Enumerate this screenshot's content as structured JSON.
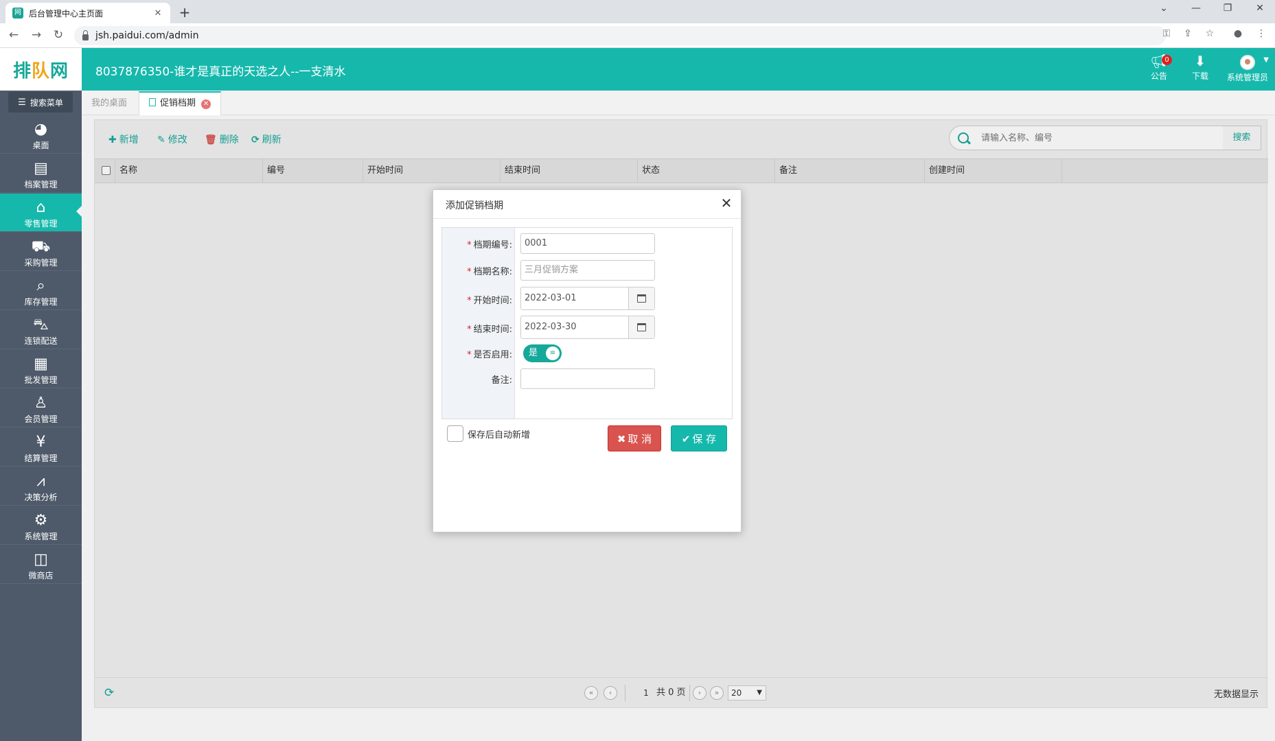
{
  "browser": {
    "tab_title": "后台管理中心主页面",
    "url": "jsh.paidui.com/admin"
  },
  "header": {
    "logo": {
      "left": "排",
      "mid": "队",
      "right": "网"
    },
    "title": "8037876350-谁才是真正的天选之人--一支清水",
    "notice_label": "公告",
    "notice_count": "0",
    "download_label": "下载",
    "user_label": "系统管理员"
  },
  "sidebar": {
    "search_label": "搜索菜单",
    "items": [
      {
        "label": "桌面",
        "icon": "dashboard-icon"
      },
      {
        "label": "档案管理",
        "icon": "archive-icon"
      },
      {
        "label": "零售管理",
        "icon": "store-icon"
      },
      {
        "label": "采购管理",
        "icon": "cart-icon"
      },
      {
        "label": "库存管理",
        "icon": "inventory-icon"
      },
      {
        "label": "连锁配送",
        "icon": "truck-icon"
      },
      {
        "label": "批发管理",
        "icon": "wholesale-icon"
      },
      {
        "label": "会员管理",
        "icon": "member-icon"
      },
      {
        "label": "结算管理",
        "icon": "settlement-icon"
      },
      {
        "label": "决策分析",
        "icon": "chart-icon"
      },
      {
        "label": "系统管理",
        "icon": "gear-icon"
      },
      {
        "label": "微商店",
        "icon": "shop-bag-icon"
      }
    ],
    "active_index": 2
  },
  "page_tabs": [
    {
      "label": "我的桌面"
    },
    {
      "label": "促销档期"
    }
  ],
  "toolbar": {
    "add_label": "新增",
    "edit_label": "修改",
    "delete_label": "删除",
    "refresh_label": "刷新",
    "search_placeholder": "请输入名称、编号",
    "search_button": "搜索"
  },
  "table": {
    "columns": [
      "名称",
      "编号",
      "开始时间",
      "结束时间",
      "状态",
      "备注",
      "创建时间"
    ]
  },
  "pager": {
    "current_page": "1",
    "total_pages": "共 0 页",
    "page_size": "20",
    "empty_text": "无数据显示"
  },
  "modal": {
    "title": "添加促销档期",
    "fields": {
      "code_label": "档期编号:",
      "code_value": "0001",
      "name_label": "档期名称:",
      "name_placeholder": "三月促销方案",
      "start_label": "开始时间:",
      "start_value": "2022-03-01",
      "end_label": "结束时间:",
      "end_value": "2022-03-30",
      "enabled_label": "是否启用:",
      "enabled_value": "是",
      "remark_label": "备注:",
      "remark_value": ""
    },
    "auto_add_label": "保存后自动新增",
    "cancel_label": "取 消",
    "save_label": "保 存"
  },
  "colors": {
    "brand": "#16b8ac",
    "sidebar": "#4e5a6a",
    "danger": "#d9534f"
  }
}
